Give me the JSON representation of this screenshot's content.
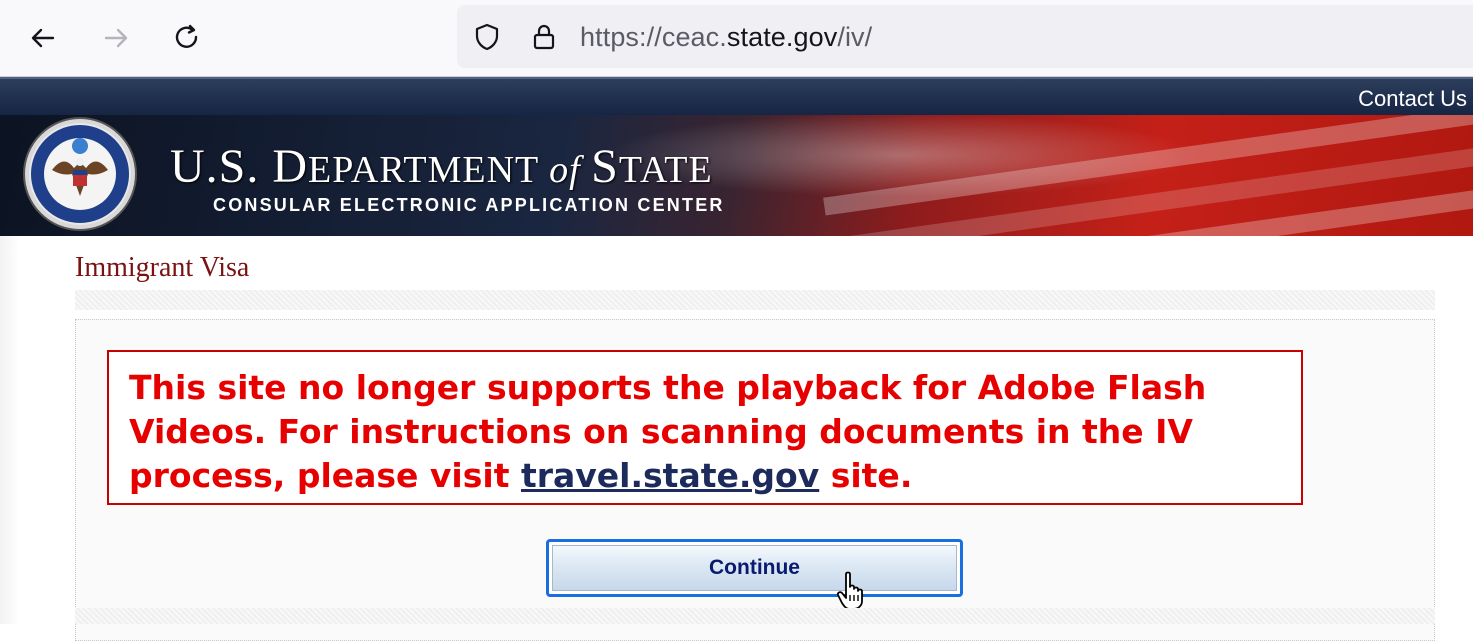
{
  "browser": {
    "url_prefix": "https://ceac.",
    "url_host": "state.gov",
    "url_path": "/iv/",
    "icons": [
      "back-arrow-icon",
      "forward-arrow-icon",
      "reload-icon",
      "shield-icon",
      "lock-icon"
    ]
  },
  "header": {
    "contact_label": "Contact Us",
    "dept_title_parts": [
      "U.S. D",
      "EPARTMENT ",
      "of ",
      "S",
      "TATE"
    ],
    "subtitle": "CONSULAR ELECTRONIC APPLICATION CENTER",
    "seal_icon": "department-of-state-seal-icon"
  },
  "main": {
    "page_title": "Immigrant Visa",
    "notice": {
      "text_before_link": "This site no longer supports the playback for Adobe Flash Videos. For instructions on scanning documents in the IV process, please visit ",
      "link_text": "travel.state.gov",
      "text_after_link": " site.",
      "color": "#e60000"
    },
    "continue_label": "Continue"
  },
  "colors": {
    "title_red": "#7a1212",
    "link_navy": "#1c2a5c",
    "button_focus": "#1a6fe0"
  }
}
